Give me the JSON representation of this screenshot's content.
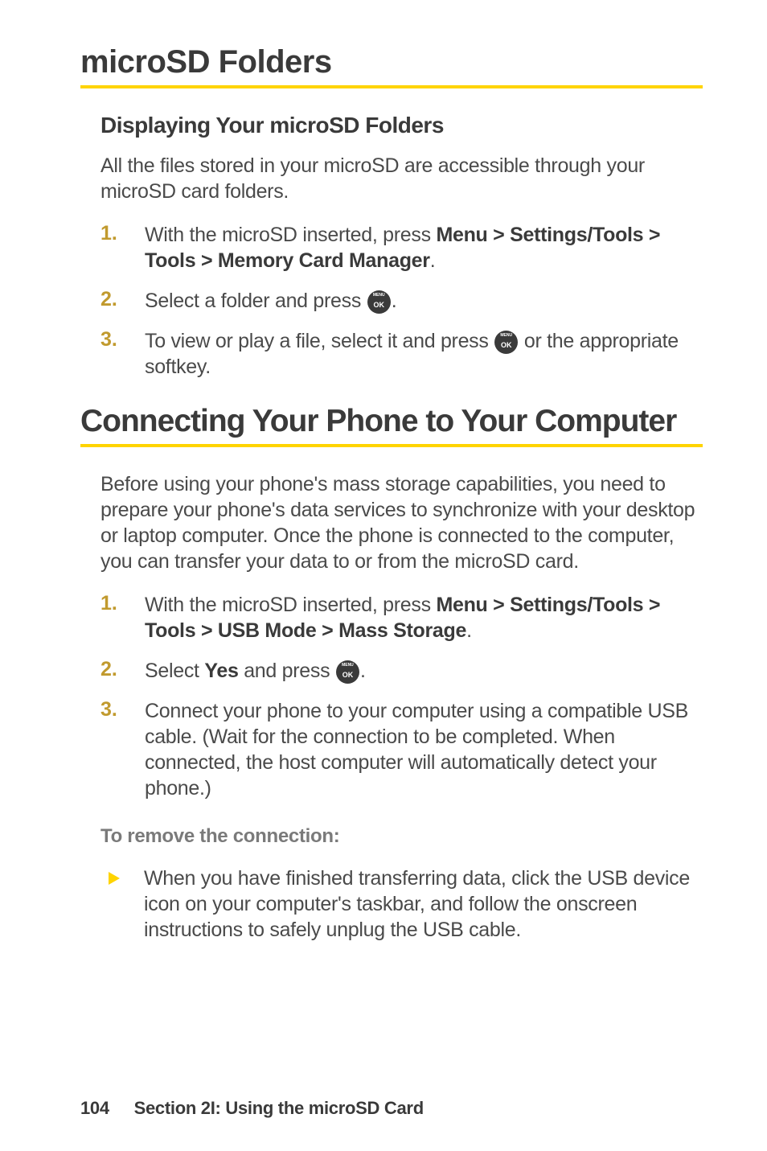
{
  "heading1": "microSD Folders",
  "subheading1": "Displaying Your microSD Folders",
  "para1": "All the files stored in your microSD are accessible through your microSD card folders.",
  "list1": {
    "item1_pre": "With the microSD inserted, press ",
    "item1_bold": "Menu > Settings/Tools > Tools > Memory Card Manager",
    "item1_post": ".",
    "item2_pre": "Select a folder and press ",
    "item2_post": ".",
    "item3_pre": "To view or play a file, select it and press ",
    "item3_post": " or the appropriate softkey."
  },
  "heading2": "Connecting Your Phone to Your Computer",
  "para2": "Before using your phone's mass storage capabilities, you need to prepare your phone's data services to synchronize with your desktop or laptop computer. Once the phone is connected to the computer, you can transfer your data to or from the microSD card.",
  "list2": {
    "item1_pre": "With the microSD inserted, press ",
    "item1_bold": "Menu > Settings/Tools > Tools > USB Mode > Mass Storage",
    "item1_post": ".",
    "item2_pre": "Select ",
    "item2_bold": "Yes",
    "item2_mid": " and press ",
    "item2_post": ".",
    "item3": "Connect your phone to your computer using a compatible USB cable. (Wait for the connection to be completed. When connected, the host computer will automatically detect your phone.)"
  },
  "subheading2": "To remove the connection:",
  "bullet1": "When you have finished transferring data, click the USB device icon on your computer's taskbar, and follow the onscreen instructions to safely unplug the USB cable.",
  "footer_page": "104",
  "footer_section": "Section 2I: Using the microSD Card",
  "num1": "1.",
  "num2": "2.",
  "num3": "3."
}
